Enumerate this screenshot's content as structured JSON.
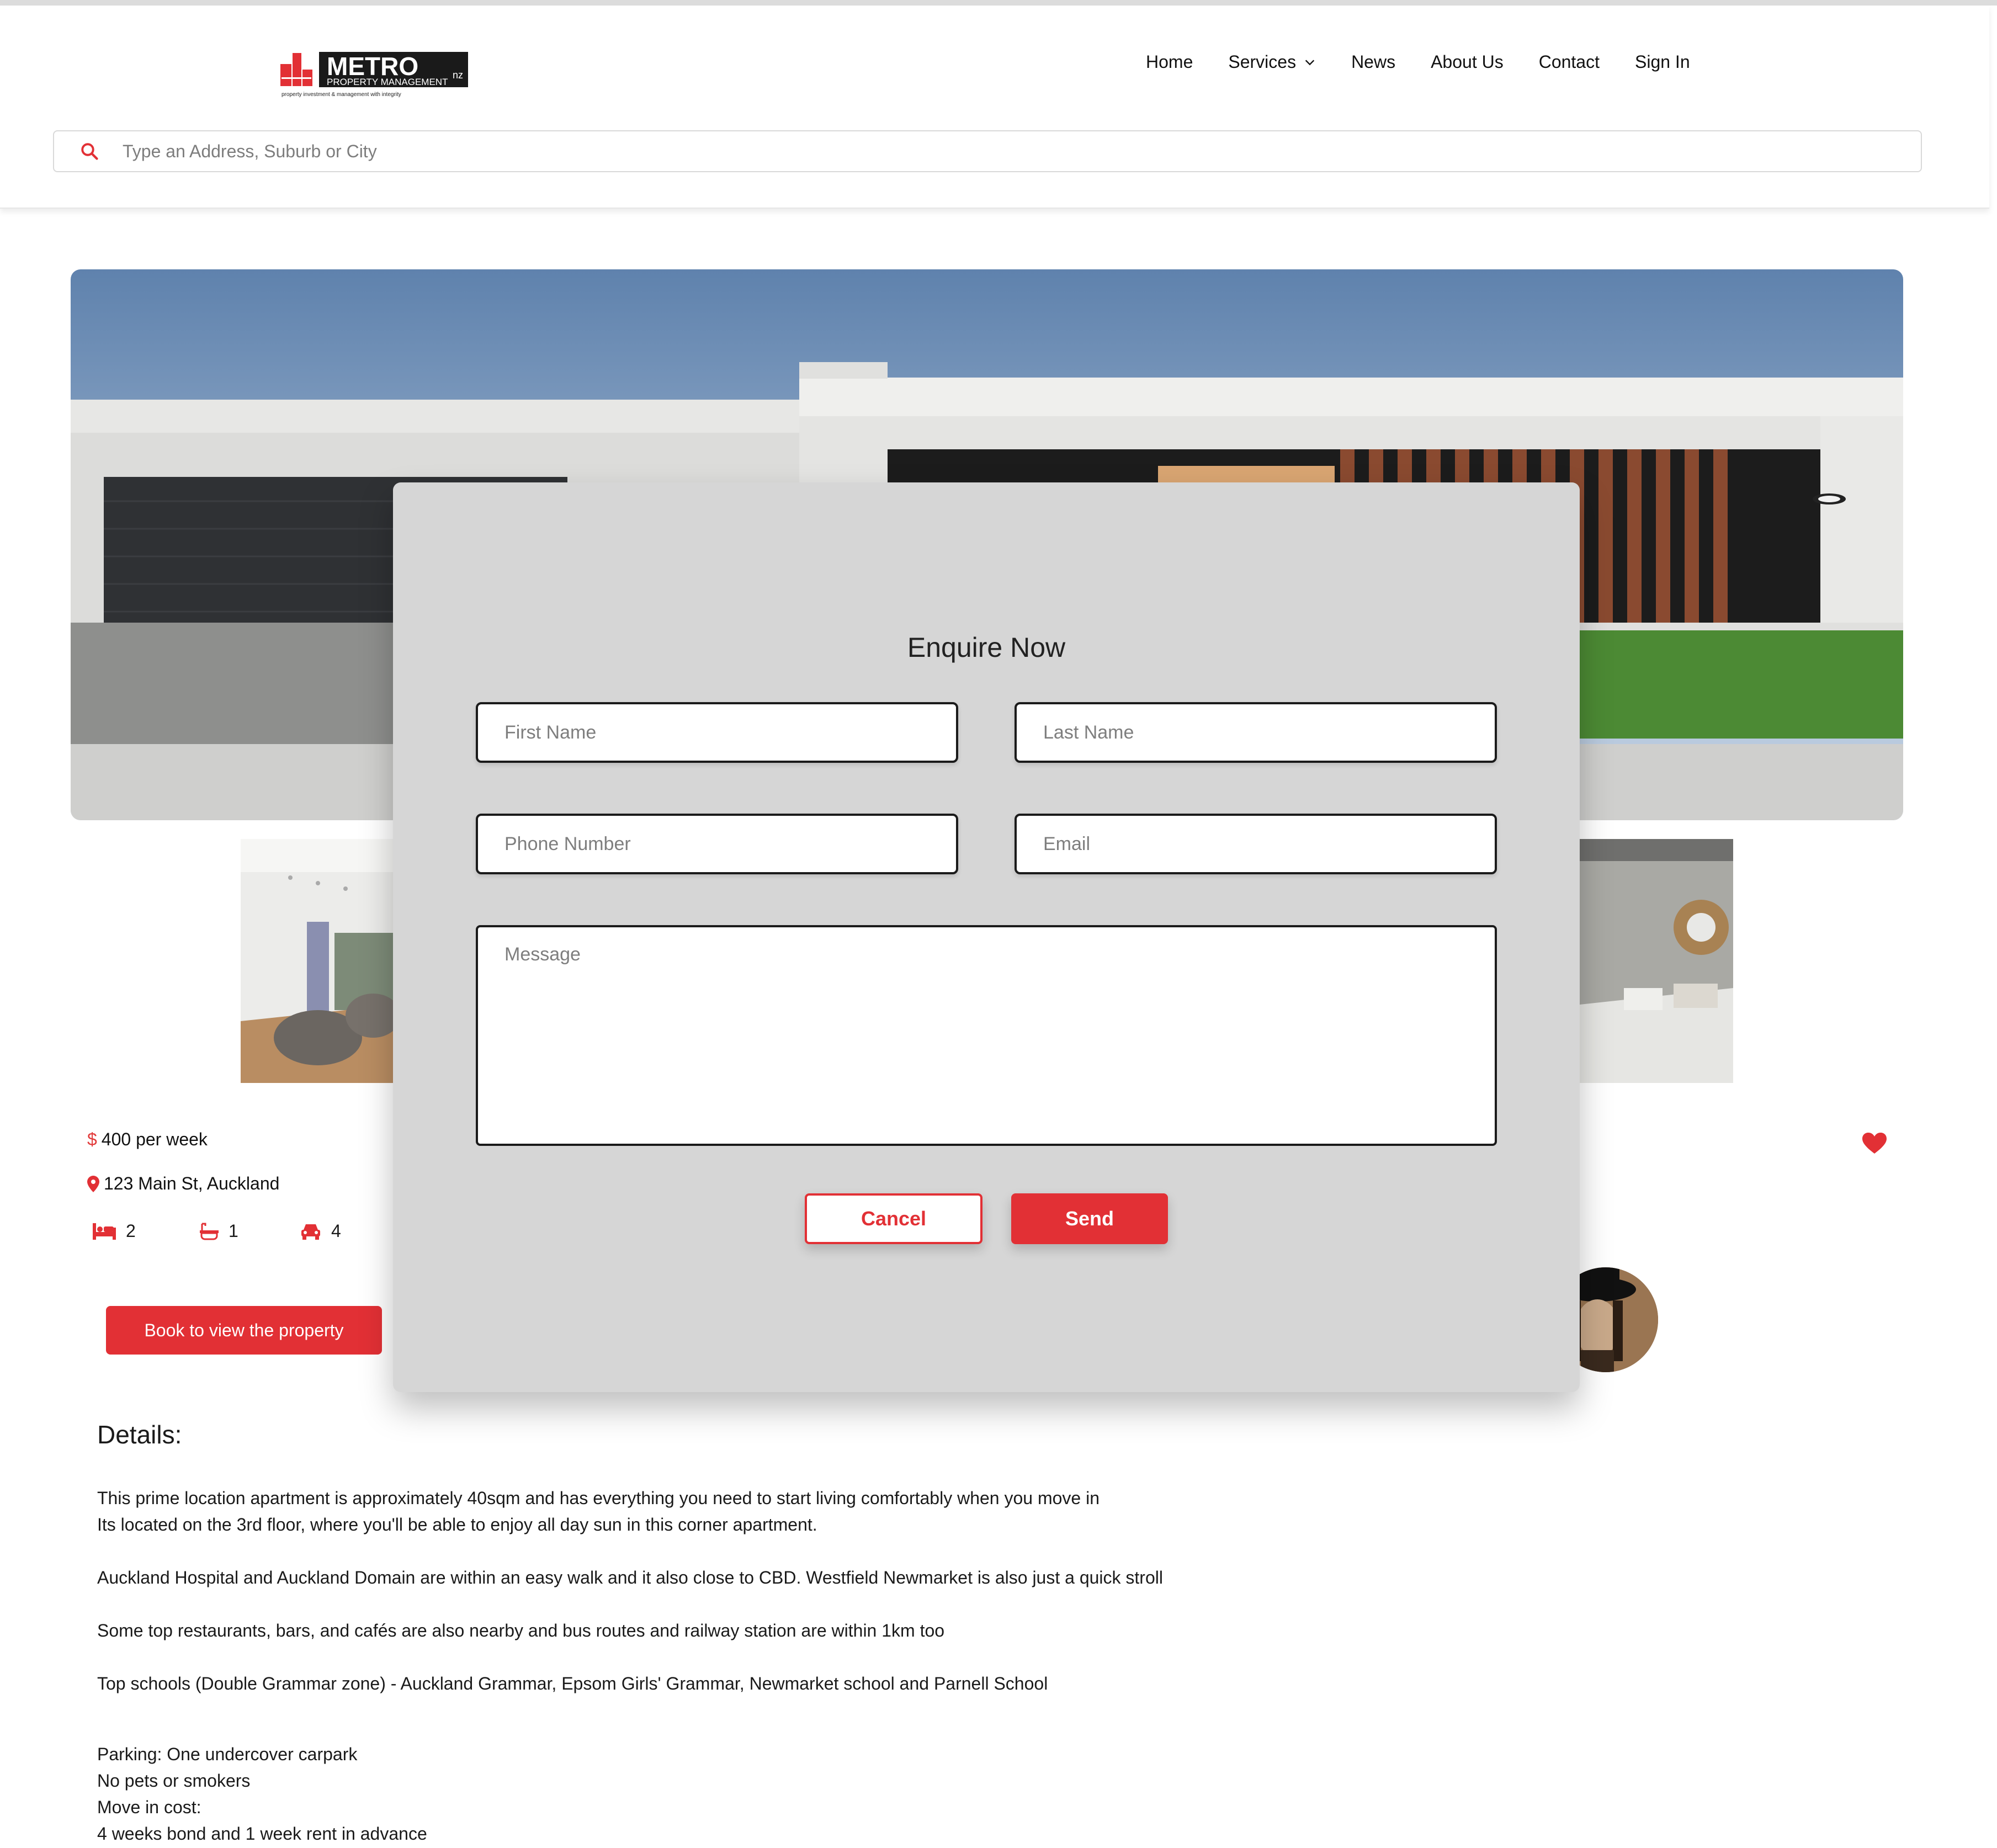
{
  "brand": {
    "logo_text": "METRO",
    "logo_suffix": "nz",
    "logo_subtitle": "PROPERTY MANAGEMENT",
    "logo_tagline": "property investment & management with integrity"
  },
  "nav": {
    "items": [
      "Home",
      "Services",
      "News",
      "About Us",
      "Contact",
      "Sign In"
    ]
  },
  "search": {
    "placeholder": "Type an Address, Suburb or City"
  },
  "listing": {
    "price_symbol": "$",
    "price": "400 per week",
    "address": "123 Main St, Auckland",
    "bedrooms": "2",
    "bathrooms": "1",
    "parking": "4",
    "book_label": "Book to view the property"
  },
  "details": {
    "title": "Details:",
    "line1": "This prime location apartment is approximately 40sqm and has everything you need to start living comfortably when you move in",
    "line2": "Its located on the 3rd floor, where you'll be able to enjoy all day sun in this corner apartment.",
    "line3": "Auckland Hospital and Auckland Domain are within an easy walk and it also close to CBD. Westfield Newmarket is also just a quick stroll",
    "line4": "Some top restaurants, bars, and cafés are also nearby and bus routes and railway station are within 1km too",
    "line5": "Top schools (Double Grammar zone) - Auckland Grammar, Epsom Girls' Grammar, Newmarket school and Parnell School",
    "line6": "Parking: One undercover carpark",
    "line7": "No pets or smokers",
    "line8": "Move in cost:",
    "line9": "4 weeks bond and 1 week rent in advance"
  },
  "modal": {
    "title": "Enquire Now",
    "first_name_placeholder": "First Name",
    "last_name_placeholder": "Last Name",
    "phone_placeholder": "Phone Number",
    "email_placeholder": "Email",
    "message_placeholder": "Message",
    "cancel_label": "Cancel",
    "send_label": "Send"
  },
  "icons": {
    "search": "search-icon",
    "dropdown": "chevron-down-icon",
    "price": "dollar-icon",
    "location": "map-pin-icon",
    "bed": "bed-icon",
    "bath": "bath-icon",
    "car": "car-icon",
    "favorite": "heart-icon"
  },
  "colors": {
    "accent": "#e23035",
    "modal_bg": "#d6d6d6",
    "text": "#1a1a1a"
  }
}
